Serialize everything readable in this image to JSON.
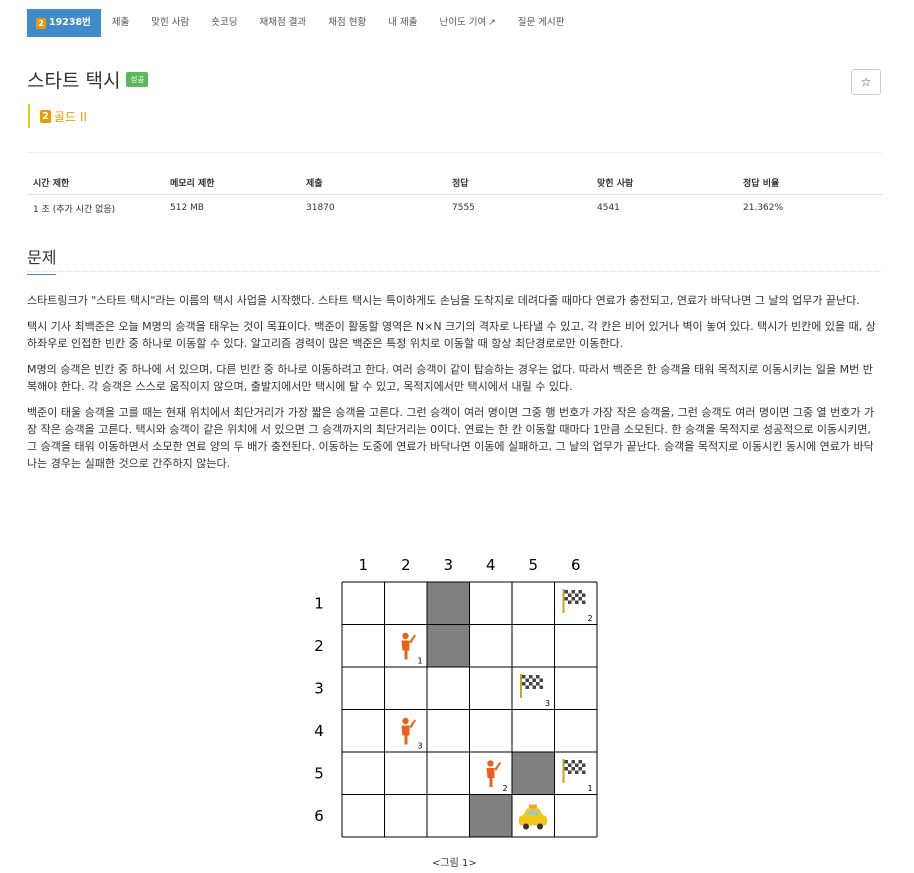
{
  "nav": {
    "items": [
      {
        "label": "19238번",
        "active": true,
        "badge": "2"
      },
      {
        "label": "제출"
      },
      {
        "label": "맞힌 사람"
      },
      {
        "label": "숏코딩"
      },
      {
        "label": "재채점 결과"
      },
      {
        "label": "채점 현황"
      },
      {
        "label": "내 제출"
      },
      {
        "label": "난이도 기여",
        "external": true
      },
      {
        "label": "질문 게시판"
      }
    ]
  },
  "header": {
    "title": "스타트 택시",
    "status_label": "성공",
    "star_icon": "star-icon",
    "tier_badge": "2",
    "tier_label": "골드 II",
    "tier_color": "#ec9a00"
  },
  "info_table": {
    "headers": [
      "시간 제한",
      "메모리 제한",
      "제출",
      "정답",
      "맞힌 사람",
      "정답 비율"
    ],
    "row": [
      "1 초 (추가 시간 없음)",
      "512 MB",
      "31870",
      "7555",
      "4541",
      "21.362%"
    ]
  },
  "section": {
    "title": "문제"
  },
  "problem": {
    "paragraphs": [
      "스타트링크가 \"스타트 택시\"라는 이름의 택시 사업을 시작했다. 스타트 택시는 특이하게도 손님을 도착지로 데려다줄 때마다 연료가 충전되고, 연료가 바닥나면 그 날의 업무가 끝난다.",
      "택시 기사 최백준은 오늘 M명의 승객을 태우는 것이 목표이다. 백준이 활동할 영역은 N×N 크기의 격자로 나타낼 수 있고, 각 칸은 비어 있거나 벽이 놓여 있다. 택시가 빈칸에 있을 때, 상하좌우로 인접한 빈칸 중 하나로 이동할 수 있다. 알고리즘 경력이 많은 백준은 특정 위치로 이동할 때 항상 최단경로로만 이동한다.",
      "M명의 승객은 빈칸 중 하나에 서 있으며, 다른 빈칸 중 하나로 이동하려고 한다. 여러 승객이 같이 탑승하는 경우는 없다. 따라서 백준은 한 승객을 태워 목적지로 이동시키는 일을 M번 반복해야 한다. 각 승객은 스스로 움직이지 않으며, 출발지에서만 택시에 탈 수 있고, 목적지에서만 택시에서 내릴 수 있다.",
      "백준이 태울 승객을 고를 때는 현재 위치에서 최단거리가 가장 짧은 승객을 고른다. 그런 승객이 여러 명이면 그중 행 번호가 가장 작은 승객을, 그런 승객도 여러 명이면 그중 열 번호가 가장 작은 승객을 고른다. 택시와 승객이 같은 위치에 서 있으면 그 승객까지의 최단거리는 0이다. 연료는 한 칸 이동할 때마다 1만큼 소모된다. 한 승객을 목적지로 성공적으로 이동시키면, 그 승객을 태워 이동하면서 소모한 연료 양의 두 배가 충전된다. 이동하는 도중에 연료가 바닥나면 이동에 실패하고, 그 날의 업무가 끝난다. 승객을 목적지로 이동시킨 동시에 연료가 바닥나는 경우는 실패한 것으로 간주하지 않는다."
    ]
  },
  "figure": {
    "col_labels": [
      "1",
      "2",
      "3",
      "4",
      "5",
      "6"
    ],
    "row_labels": [
      "1",
      "2",
      "3",
      "4",
      "5",
      "6"
    ],
    "walls": [
      [
        1,
        3
      ],
      [
        2,
        3
      ],
      [
        5,
        5
      ],
      [
        6,
        4
      ]
    ],
    "passengers": [
      {
        "row": 2,
        "col": 2,
        "label": "1"
      },
      {
        "row": 4,
        "col": 2,
        "label": "3"
      },
      {
        "row": 5,
        "col": 4,
        "label": "2"
      }
    ],
    "destinations": [
      {
        "row": 1,
        "col": 6,
        "label": "2"
      },
      {
        "row": 3,
        "col": 5,
        "label": "3"
      },
      {
        "row": 5,
        "col": 6,
        "label": "1"
      }
    ],
    "taxi": {
      "row": 6,
      "col": 5
    },
    "wall_color": "#808080",
    "passenger_color": "#e8621a",
    "taxi_color": "#f5c518",
    "caption": "<그림 1>"
  }
}
